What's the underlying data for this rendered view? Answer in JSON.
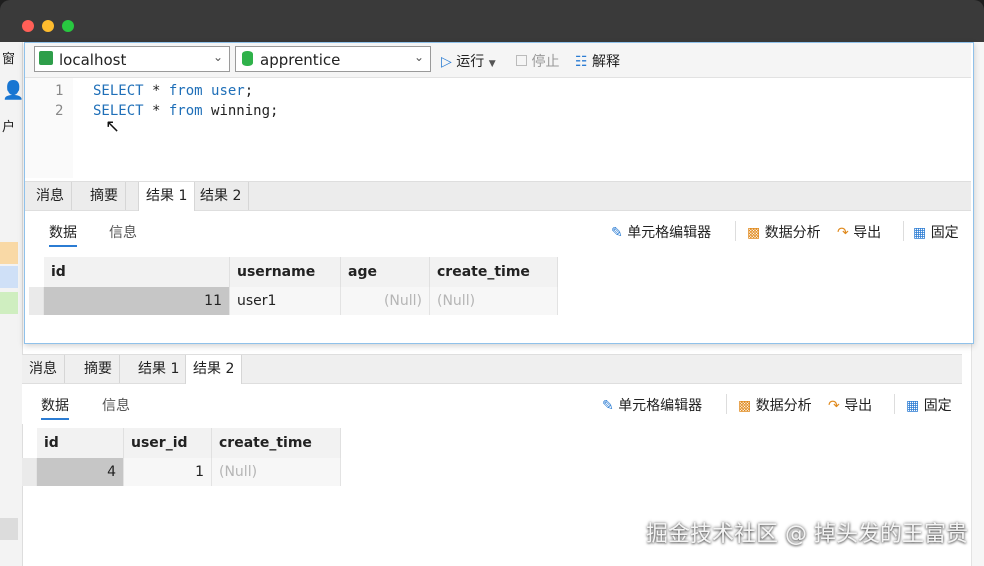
{
  "toolbar": {
    "connection": "localhost",
    "database": "apprentice",
    "run_label": "运行",
    "stop_label": "停止",
    "explain_label": "解释"
  },
  "left_strip": {
    "label_top": "窗",
    "label_user": "户"
  },
  "editor": {
    "lines": [
      {
        "num": "1",
        "kw1": "SELECT",
        "mid": " * ",
        "kw2": "from",
        "rest_kw": " user",
        "end": ";"
      },
      {
        "num": "2",
        "kw1": "SELECT",
        "mid": " * ",
        "kw2": "from",
        "rest_kw": "",
        "end": " winning;"
      }
    ]
  },
  "result_tabs_top": [
    "消息",
    "摘要",
    "结果 1",
    "结果 2"
  ],
  "result_tabs_bottom": [
    "消息",
    "摘要",
    "结果 1",
    "结果 2"
  ],
  "subtabs": {
    "data": "数据",
    "info": "信息"
  },
  "actions": {
    "cell_editor": "单元格编辑器",
    "analysis": "数据分析",
    "export": "导出",
    "pin": "固定"
  },
  "result1": {
    "columns": [
      "id",
      "username",
      "age",
      "create_time"
    ],
    "row": [
      "11",
      "user1",
      "(Null)",
      "(Null)"
    ]
  },
  "result2": {
    "columns": [
      "id",
      "user_id",
      "create_time"
    ],
    "row": [
      "4",
      "1",
      "(Null)"
    ]
  },
  "watermark": "掘金技术社区 @ 掉头发的王富贵",
  "colors": {
    "accent": "#2b7cd3",
    "keyword": "#1f6fb8"
  }
}
